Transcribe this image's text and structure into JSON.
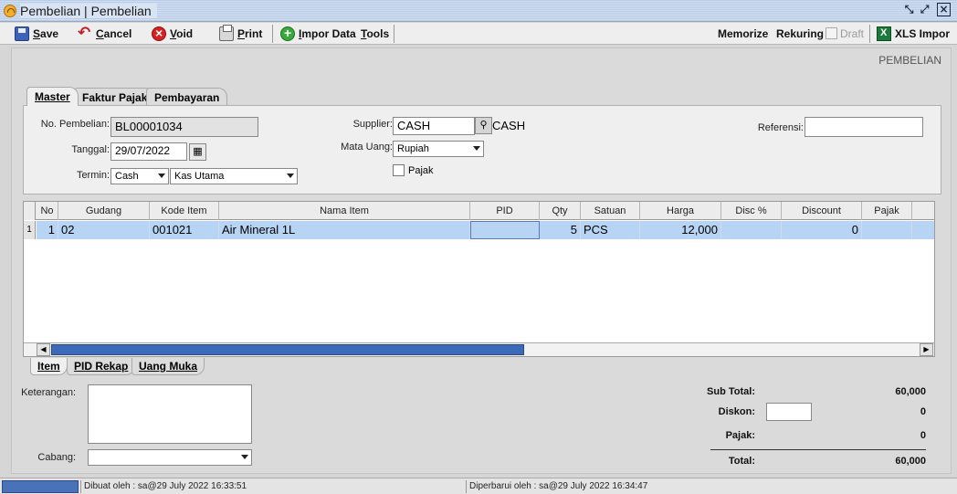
{
  "window": {
    "title": "Pembelian | Pembelian"
  },
  "toolbar": {
    "save": "Save",
    "cancel": "Cancel",
    "void": "Void",
    "print": "Print",
    "import_data": "Impor Data",
    "tools": "Tools",
    "memorize": "Memorize",
    "rekuring": "Rekuring",
    "draft": "Draft",
    "xls_import": "XLS Impor"
  },
  "page_heading": "PEMBELIAN",
  "tabs": [
    "Master",
    "Faktur Pajak",
    "Pembayaran"
  ],
  "form": {
    "no_pembelian_label": "No. Pembelian:",
    "no_pembelian": "BL00001034",
    "tanggal_label": "Tanggal:",
    "tanggal": "29/07/2022",
    "termin_label": "Termin:",
    "termin": "Cash",
    "kas": "Kas Utama",
    "supplier_label": "Supplier:",
    "supplier_code": "CASH",
    "supplier_name": "CASH",
    "mata_uang_label": "Mata Uang:",
    "mata_uang": "Rupiah",
    "pajak_label": "Pajak",
    "pajak_checked": false,
    "referensi_label": "Referensi:",
    "referensi": ""
  },
  "grid": {
    "columns": [
      "No",
      "Gudang",
      "Kode Item",
      "Nama Item",
      "PID",
      "Qty",
      "Satuan",
      "Harga",
      "Disc %",
      "Discount",
      "Pajak"
    ],
    "rows": [
      {
        "row_header": "1",
        "no": "1",
        "gudang": "02",
        "kode_item": "001021",
        "nama_item": "Air Mineral 1L",
        "pid": "",
        "qty": "5",
        "satuan": "PCS",
        "harga": "12,000",
        "disc_pct": "",
        "discount": "0",
        "pajak": ""
      }
    ]
  },
  "bottom_tabs": [
    "Item",
    "PID Rekap",
    "Uang Muka"
  ],
  "footer": {
    "keterangan_label": "Keterangan:",
    "keterangan": "",
    "cabang_label": "Cabang:",
    "cabang": ""
  },
  "totals": {
    "sub_total_label": "Sub Total:",
    "sub_total": "60,000",
    "diskon_label": "Diskon:",
    "diskon_input": "",
    "diskon": "0",
    "pajak_label": "Pajak:",
    "pajak": "0",
    "total_label": "Total:",
    "total": "60,000"
  },
  "status": {
    "created": "Dibuat oleh : sa@29 July 2022  16:33:51",
    "updated": "Diperbarui oleh : sa@29 July 2022  16:34:47"
  }
}
